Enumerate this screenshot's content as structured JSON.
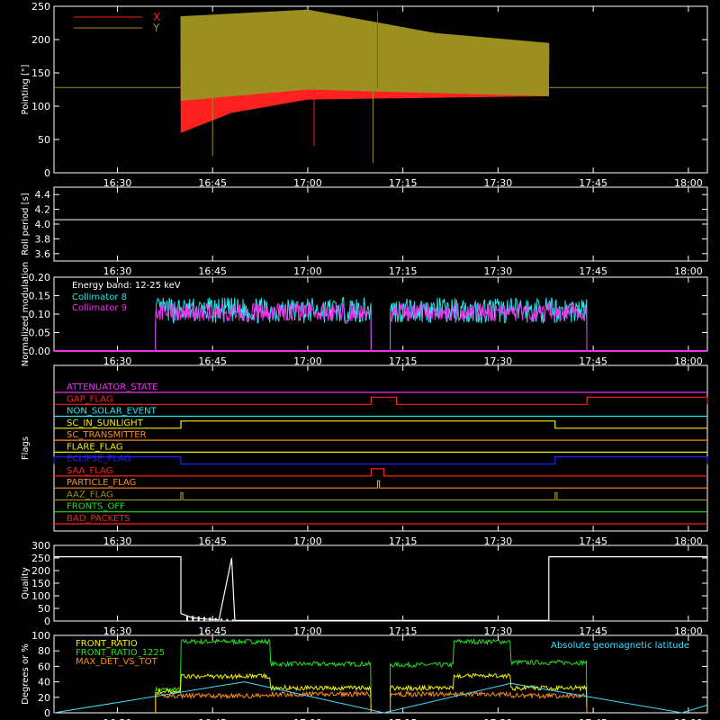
{
  "colors": {
    "background": "#000000",
    "axis": "#ffffff",
    "red": "#ff2020",
    "olive": "#9b8f1f",
    "cyan": "#20e8ee",
    "magenta": "#ee33ee",
    "yellow": "#f2f000",
    "green": "#20e020",
    "orange": "#ff8c1a",
    "blue": "#2020ff",
    "skyblue": "#40e0ff"
  },
  "time_ticks": [
    "16:30",
    "16:45",
    "17:00",
    "17:15",
    "17:30",
    "17:45",
    "18:00"
  ],
  "chart_data": [
    {
      "id": "pointing",
      "type": "line",
      "ylabel": "Pointing [\"]",
      "ylim": [
        0,
        250
      ],
      "yticks": [
        "0",
        "50",
        "100",
        "150",
        "200",
        "250"
      ],
      "legend": [
        {
          "name": "X",
          "color": "red"
        },
        {
          "name": "Y",
          "color": "olive"
        }
      ],
      "reference_level": 128,
      "series": [
        {
          "name": "X",
          "color": "red",
          "start": "16:40",
          "end": "17:38",
          "envelope_low": [
            [
              0,
              60
            ],
            [
              8,
              90
            ],
            [
              20,
              110
            ],
            [
              58,
              115
            ]
          ],
          "envelope_high": [
            [
              0,
              200
            ],
            [
              20,
              210
            ],
            [
              40,
              190
            ],
            [
              58,
              185
            ]
          ]
        },
        {
          "name": "Y",
          "color": "olive",
          "start": "16:40",
          "end": "17:38",
          "envelope_low": [
            [
              0,
              108
            ],
            [
              20,
              125
            ],
            [
              58,
              115
            ]
          ],
          "envelope_high": [
            [
              0,
              235
            ],
            [
              20,
              245
            ],
            [
              40,
              210
            ],
            [
              58,
              195
            ]
          ]
        }
      ]
    },
    {
      "id": "roll",
      "type": "line",
      "ylabel": "Roll period [s]",
      "ylim": [
        3.5,
        4.5
      ],
      "yticks": [
        "3.6",
        "3.8",
        "4.0",
        "4.2",
        "4.4"
      ],
      "series": [
        {
          "name": "Roll period",
          "color": "axis",
          "value": 4.06
        }
      ]
    },
    {
      "id": "modulation",
      "type": "line",
      "ylabel": "Normalized modulation",
      "ylim": [
        0,
        0.2
      ],
      "yticks": [
        "0.00",
        "0.05",
        "0.10",
        "0.15",
        "0.20"
      ],
      "annotation": "Energy band: 12-25 keV",
      "legend": [
        {
          "name": "Collimator 8",
          "color": "cyan"
        },
        {
          "name": "Collimator 9",
          "color": "magenta"
        }
      ],
      "segments": [
        [
          "16:36",
          "17:10"
        ],
        [
          "17:13",
          "17:44"
        ]
      ],
      "series": [
        {
          "name": "Collimator 8",
          "color": "cyan",
          "mean": 0.11,
          "spread": 0.035
        },
        {
          "name": "Collimator 9",
          "color": "magenta",
          "mean": 0.105,
          "spread": 0.025
        }
      ]
    },
    {
      "id": "flags",
      "type": "step",
      "ylabel": "Flags",
      "flags": [
        {
          "name": "ATTENUATOR_STATE",
          "color": "magenta",
          "on": []
        },
        {
          "name": "GAP_FLAG",
          "color": "red",
          "on": [
            [
              "17:10",
              "17:14"
            ],
            [
              "17:44",
              "18:03"
            ]
          ]
        },
        {
          "name": "NON_SOLAR_EVENT",
          "color": "cyan",
          "on": []
        },
        {
          "name": "SC_IN_SUNLIGHT",
          "color": "yellow",
          "on": [
            [
              "16:40",
              "17:39"
            ]
          ]
        },
        {
          "name": "SC_TRANSMITTER",
          "color": "orange",
          "on": []
        },
        {
          "name": "FLARE_FLAG",
          "color": "yellow",
          "on": []
        },
        {
          "name": "ECLIPSE_FLAG",
          "color": "blue",
          "on": [
            [
              "16:20",
              "16:40"
            ],
            [
              "17:39",
              "18:03"
            ]
          ]
        },
        {
          "name": "SAA_FLAG",
          "color": "red",
          "on": [
            [
              "17:10",
              "17:12"
            ]
          ]
        },
        {
          "name": "PARTICLE_FLAG",
          "color": "orange",
          "on": [
            [
              "17:11",
              "17:11.3"
            ]
          ]
        },
        {
          "name": "AAZ_FLAG",
          "color": "olive",
          "on": [
            [
              "16:40",
              "16:40.3"
            ],
            [
              "17:39",
              "17:39.3"
            ]
          ]
        },
        {
          "name": "FRONTS_OFF",
          "color": "green",
          "on": []
        },
        {
          "name": "BAD_PACKETS",
          "color": "red",
          "on": []
        }
      ]
    },
    {
      "id": "quality",
      "type": "line",
      "ylabel": "Quality",
      "ylim": [
        0,
        300
      ],
      "yticks": [
        "0",
        "50",
        "100",
        "150",
        "200",
        "250",
        "300"
      ],
      "series": [
        {
          "name": "Quality",
          "color": "axis",
          "points": [
            [
              "16:20",
              255
            ],
            [
              "16:40",
              255
            ],
            [
              "16:40",
              30
            ],
            [
              "16:41",
              20
            ],
            [
              "16:42",
              12
            ],
            [
              "16:44",
              8
            ],
            [
              "16:46",
              5
            ],
            [
              "16:48",
              250
            ],
            [
              "16:48.5",
              3
            ],
            [
              "17:00",
              2
            ],
            [
              "17:38",
              2
            ],
            [
              "17:38",
              255
            ],
            [
              "18:03",
              255
            ]
          ]
        }
      ]
    },
    {
      "id": "ratios",
      "type": "line",
      "ylabel": "Degrees or %",
      "ylim": [
        0,
        100
      ],
      "yticks": [
        "0",
        "20",
        "40",
        "60",
        "80",
        "100"
      ],
      "legend": [
        {
          "name": "FRONT_RATIO",
          "color": "yellow"
        },
        {
          "name": "FRONT_RATIO_1225",
          "color": "green"
        },
        {
          "name": "MAX_DET_VS_TOT",
          "color": "orange"
        }
      ],
      "legend_right": {
        "name": "Absolute geomagnetic latitude",
        "color": "skyblue"
      },
      "segments": [
        [
          "16:36",
          "17:10"
        ],
        [
          "17:13",
          "17:44"
        ]
      ],
      "series": [
        {
          "name": "FRONT_RATIO_1225",
          "color": "green",
          "levels": [
            [
              "16:36",
              30
            ],
            [
              "16:40",
              92
            ],
            [
              "16:54",
              63
            ],
            [
              "17:10",
              30
            ],
            [
              "17:13",
              62
            ],
            [
              "17:23",
              92
            ],
            [
              "17:32",
              65
            ]
          ]
        },
        {
          "name": "FRONT_RATIO",
          "color": "yellow",
          "levels": [
            [
              "16:36",
              28
            ],
            [
              "16:40",
              47
            ],
            [
              "16:54",
              32
            ],
            [
              "17:10",
              30
            ],
            [
              "17:13",
              32
            ],
            [
              "17:23",
              48
            ],
            [
              "17:32",
              32
            ]
          ]
        },
        {
          "name": "MAX_DET_VS_TOT",
          "color": "orange",
          "levels": [
            [
              "16:36",
              22
            ],
            [
              "16:40",
              22
            ],
            [
              "16:54",
              24
            ],
            [
              "17:10",
              25
            ],
            [
              "17:13",
              24
            ],
            [
              "17:23",
              24
            ],
            [
              "17:32",
              22
            ]
          ]
        },
        {
          "name": "Absolute geomagnetic latitude",
          "color": "skyblue",
          "points": [
            [
              "16:20",
              0
            ],
            [
              "16:50",
              40
            ],
            [
              "17:12",
              0
            ],
            [
              "17:32",
              38
            ],
            [
              "17:59",
              0
            ],
            [
              "18:03",
              10
            ]
          ]
        }
      ]
    }
  ]
}
